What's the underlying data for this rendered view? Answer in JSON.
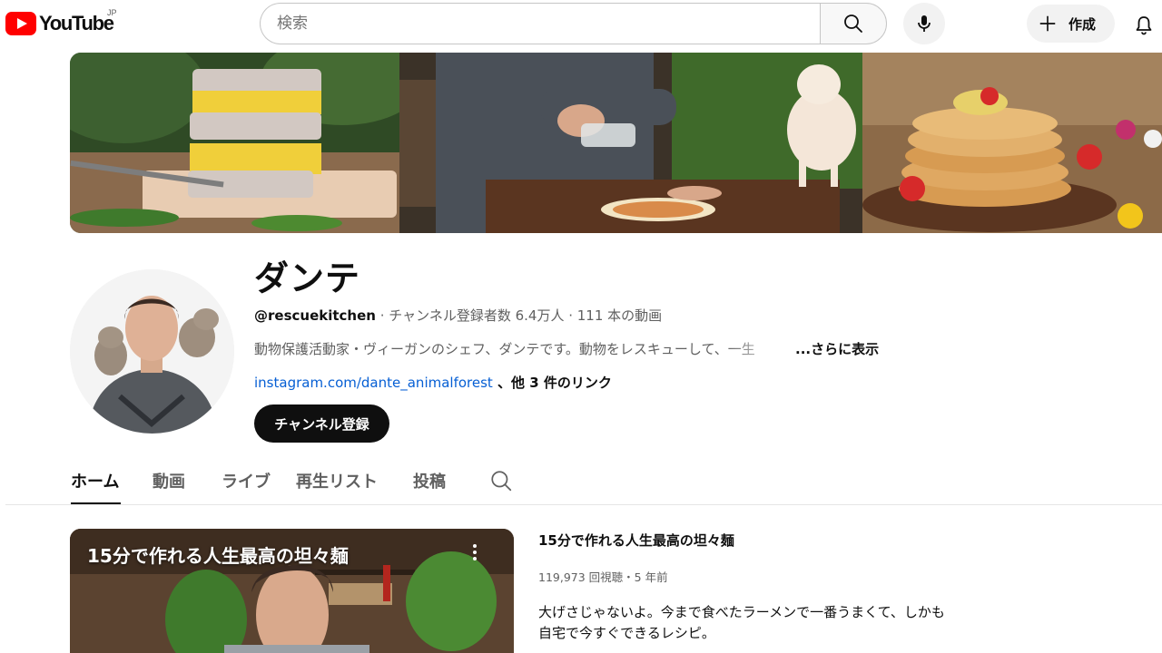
{
  "header": {
    "logo_text": "YouTube",
    "region": "JP",
    "search_placeholder": "検索",
    "create_label": "作成"
  },
  "channel": {
    "name": "ダンテ",
    "handle": "@rescuekitchen",
    "meta_sep1": " · ",
    "subscribers": "チャンネル登録者数 6.4万人",
    "meta_sep2": " · ",
    "video_count": "111 本の動画",
    "description": "動物保護活動家・ヴィーガンのシェフ、ダンテです。動物をレスキューして、一生",
    "more_label": "...さらに表示",
    "link_url": "instagram.com/dante_animalforest",
    "link_more": " 、他 3 件のリンク",
    "subscribe_label": "チャンネル登録"
  },
  "tabs": [
    {
      "label": "ホーム",
      "active": true
    },
    {
      "label": "動画",
      "active": false
    },
    {
      "label": "ライブ",
      "active": false
    },
    {
      "label": "再生リスト",
      "active": false
    },
    {
      "label": "投稿",
      "active": false
    }
  ],
  "featured_video": {
    "thumbnail_title": "15分で作れる人生最高の坦々麺",
    "title": "15分で作れる人生最高の坦々麺",
    "stats": "119,973 回視聴・5 年前",
    "description": "大げさじゃないよ。今まで食べたラーメンで一番うまくて、しかも自宅で今すぐできるレシピ。"
  },
  "icons": {
    "search": "search-icon",
    "mic": "mic-icon",
    "create": "plus-icon",
    "bell": "bell-icon",
    "more": "more-vert-icon"
  },
  "colors": {
    "brand_red": "#ff0000",
    "link_blue": "#065fd4",
    "text_primary": "#0f0f0f",
    "text_secondary": "#606060"
  }
}
